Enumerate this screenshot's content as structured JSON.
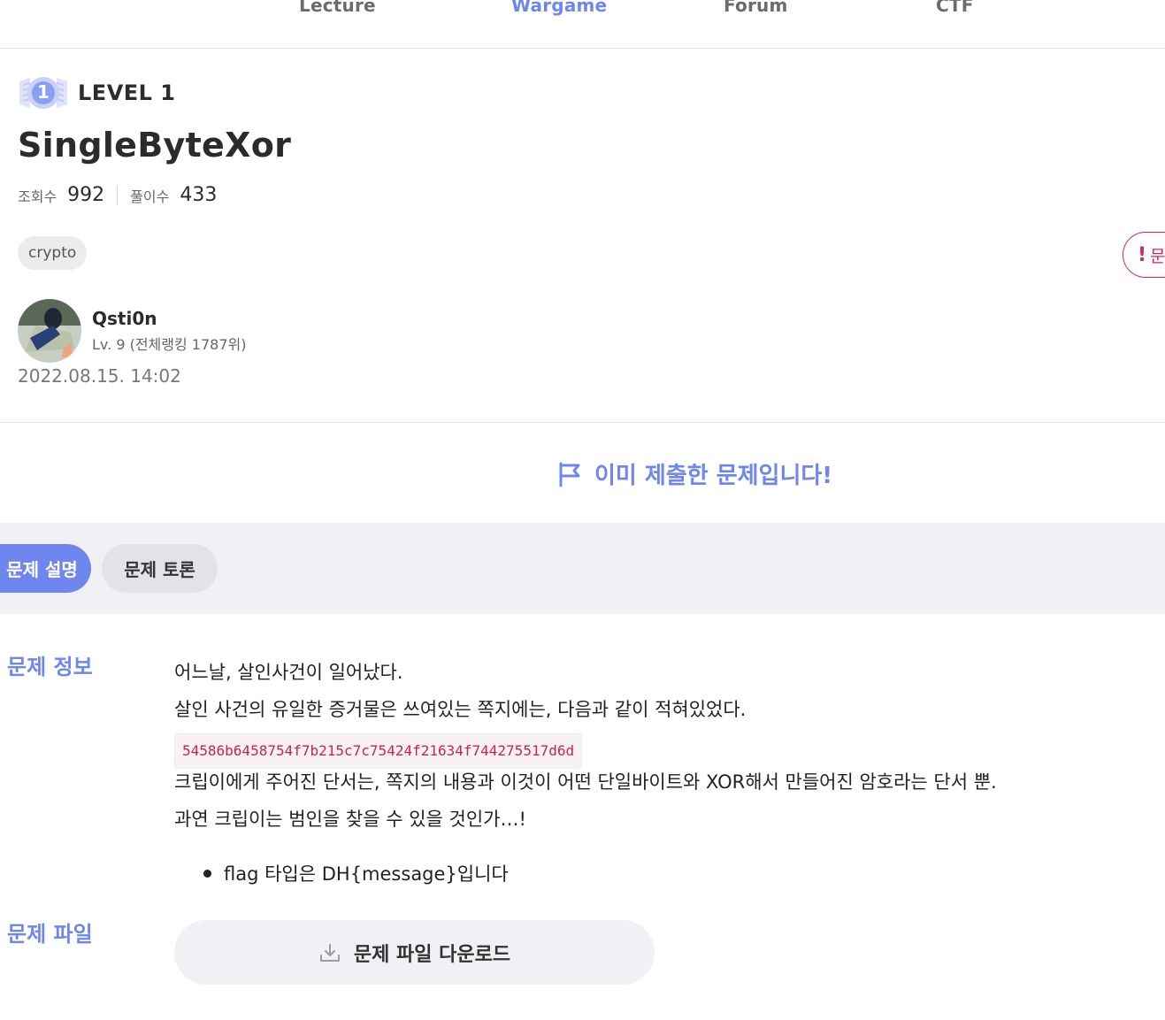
{
  "nav": {
    "items": [
      {
        "label": "Lecture",
        "active": false
      },
      {
        "label": "Wargame",
        "active": true
      },
      {
        "label": "Forum",
        "active": false
      },
      {
        "label": "CTF",
        "active": false
      }
    ]
  },
  "challenge": {
    "level_label": "LEVEL 1",
    "level_badge": "1",
    "title": "SingleByteXor",
    "views_label": "조회수",
    "views": "992",
    "solves_label": "풀이수",
    "solves": "433",
    "tag": "crypto",
    "report_label": "문"
  },
  "author": {
    "name": "Qsti0n",
    "rank": "Lv. 9 (전체랭킹 1787위)",
    "date": "2022.08.15. 14:02"
  },
  "status": {
    "submitted": "이미 제출한 문제입니다!"
  },
  "tabs": [
    {
      "label": "문제 설명",
      "active": true
    },
    {
      "label": "문제 토론",
      "active": false
    }
  ],
  "info": {
    "section_label": "문제 정보",
    "line1": "어느날, 살인사건이 일어났다.",
    "line2": "살인 사건의 유일한 증거물은 쓰여있는 쪽지에는, 다음과 같이 적혀있었다.",
    "code": "54586b6458754f7b215c7c75424f21634f744275517d6d",
    "line3": "크립이에게 주어진 단서는, 쪽지의 내용과 이것이 어떤 단일바이트와 XOR해서 만들어진 암호라는 단서 뿐.",
    "line4": "과연 크립이는 범인을 찾을 수 있을 것인가…!",
    "bullet": "flag 타입은 DH{message}입니다"
  },
  "files": {
    "section_label": "문제 파일",
    "download_label": "문제 파일 다운로드"
  },
  "colors": {
    "accent": "#6f86ee",
    "danger": "#d8226b",
    "code_text": "#c7254e"
  }
}
